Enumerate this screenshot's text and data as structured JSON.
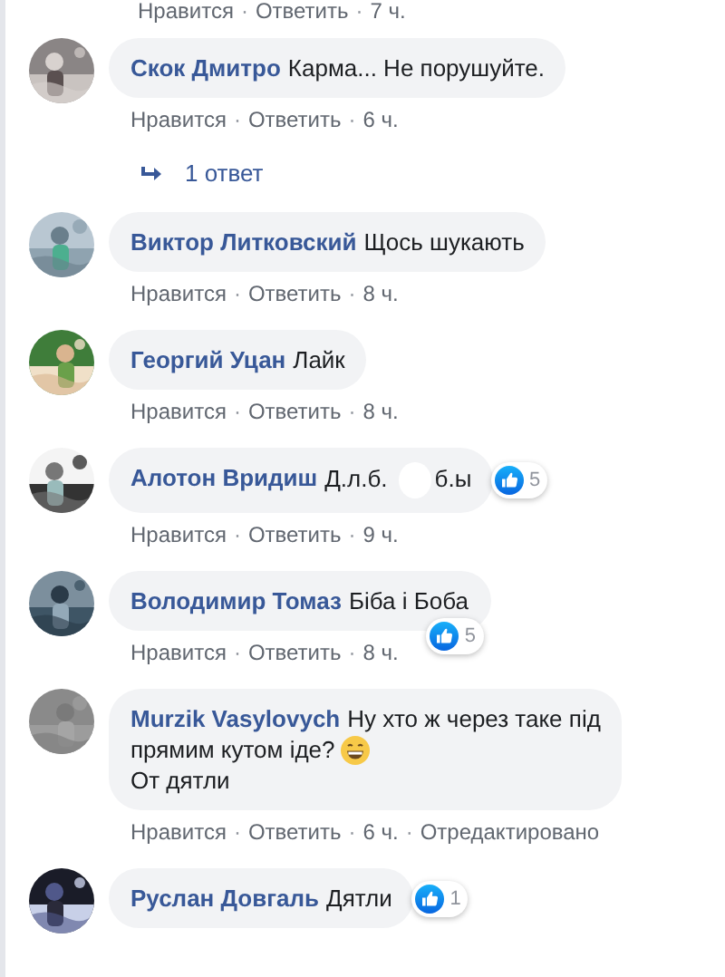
{
  "separator": "·",
  "top_meta": {
    "like": "Нравится",
    "reply": "Ответить",
    "time": "7 ч."
  },
  "comments": [
    {
      "avatar": {
        "kind": "picture"
      },
      "name": "Скок Дмитро",
      "segments": [
        {
          "kind": "text",
          "text": "Карма... Не порушуйте."
        }
      ],
      "meta": {
        "like": "Нравится",
        "reply": "Ответить",
        "time": "6 ч."
      },
      "replies": {
        "label": "1 ответ"
      }
    },
    {
      "avatar": {
        "kind": "picture"
      },
      "name": "Виктор Литковский",
      "segments": [
        {
          "kind": "text",
          "text": "Щось шукають"
        }
      ],
      "meta": {
        "like": "Нравится",
        "reply": "Ответить",
        "time": "8 ч."
      }
    },
    {
      "avatar": {
        "kind": "picture"
      },
      "name": "Георгий Уцан",
      "segments": [
        {
          "kind": "text",
          "text": "Лайк"
        }
      ],
      "meta": {
        "like": "Нравится",
        "reply": "Ответить",
        "time": "8 ч."
      }
    },
    {
      "avatar": {
        "kind": "picture"
      },
      "name": "Алотон Вридиш",
      "segments": [
        {
          "kind": "text",
          "text": "Д.л.б."
        },
        {
          "kind": "redacted"
        },
        {
          "kind": "text",
          "text": "б.ы"
        }
      ],
      "reactions": {
        "count": "5",
        "kind": "side"
      },
      "meta": {
        "like": "Нравится",
        "reply": "Ответить",
        "time": "9 ч."
      }
    },
    {
      "avatar": {
        "kind": "picture"
      },
      "name": "Володимир Томаз",
      "segments": [
        {
          "kind": "text",
          "text": "Біба і Боба"
        }
      ],
      "reactions": {
        "count": "5",
        "kind": "below"
      },
      "meta": {
        "like": "Нравится",
        "reply": "Ответить",
        "time": "8 ч."
      }
    },
    {
      "avatar": {
        "kind": "picture"
      },
      "name": "Murzik Vasylovych",
      "segments": [
        {
          "kind": "text",
          "text": "Ну хто ж через таке під"
        },
        {
          "kind": "break"
        },
        {
          "kind": "text",
          "text": "прямим кутом іде?"
        },
        {
          "kind": "emoji"
        },
        {
          "kind": "break"
        },
        {
          "kind": "text",
          "text": "От дятли"
        }
      ],
      "meta": {
        "like": "Нравится",
        "reply": "Ответить",
        "time": "6 ч.",
        "edited": "Отредактировано"
      }
    },
    {
      "avatar": {
        "kind": "picture"
      },
      "name": "Руслан Довгаль",
      "segments": [
        {
          "kind": "text",
          "text": "Дятли"
        }
      ],
      "reactions": {
        "count": "1",
        "kind": "side"
      }
    }
  ]
}
